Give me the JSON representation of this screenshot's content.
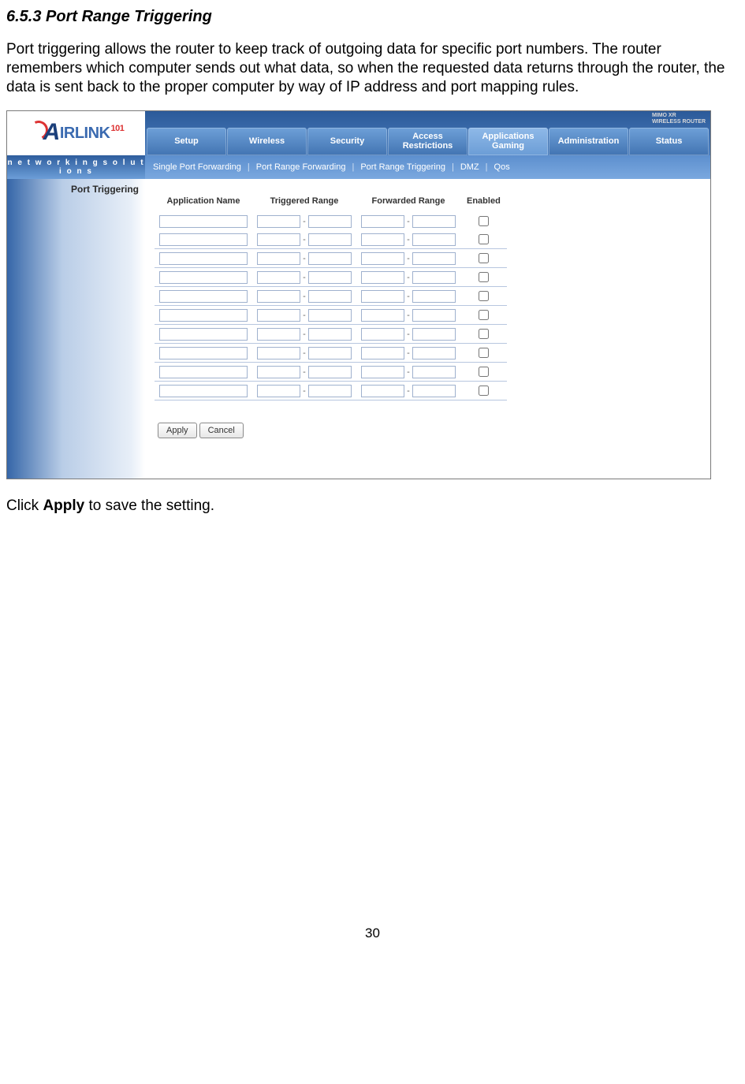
{
  "section_heading": "6.5.3 Port Range Triggering",
  "intro_paragraph": "Port triggering allows the router to keep track of outgoing data for specific port numbers. The router remembers which computer sends out what data, so when the requested data returns through the router, the data is sent back to the proper computer by way of IP address and port mapping rules.",
  "apply_sentence_pre": "Click ",
  "apply_sentence_bold": "Apply",
  "apply_sentence_post": " to save the setting.",
  "page_number": "30",
  "logo": {
    "brand_a": "A",
    "brand_rest": "IRLINK",
    "brand_sub": "101"
  },
  "brand_slug": "n e t w o r k i n g s o l u t i o n s",
  "brand_badge_line1": "MIMO  XR",
  "brand_badge_line2": "WIRELESS ROUTER",
  "tabs": [
    {
      "label": "Setup"
    },
    {
      "label": "Wireless"
    },
    {
      "label": "Security"
    },
    {
      "label": "Access Restrictions"
    },
    {
      "label": "Applications Gaming"
    },
    {
      "label": "Administration"
    },
    {
      "label": "Status"
    }
  ],
  "active_tab_index": 4,
  "subnav": [
    "Single Port Forwarding",
    "Port Range Forwarding",
    "Port Range Triggering",
    "DMZ",
    "Qos"
  ],
  "side_title": "Port Triggering",
  "table": {
    "headers": {
      "app": "Application Name",
      "trig": "Triggered Range",
      "fwd": "Forwarded Range",
      "en": "Enabled"
    },
    "row_count": 10
  },
  "buttons": {
    "apply": "Apply",
    "cancel": "Cancel"
  }
}
